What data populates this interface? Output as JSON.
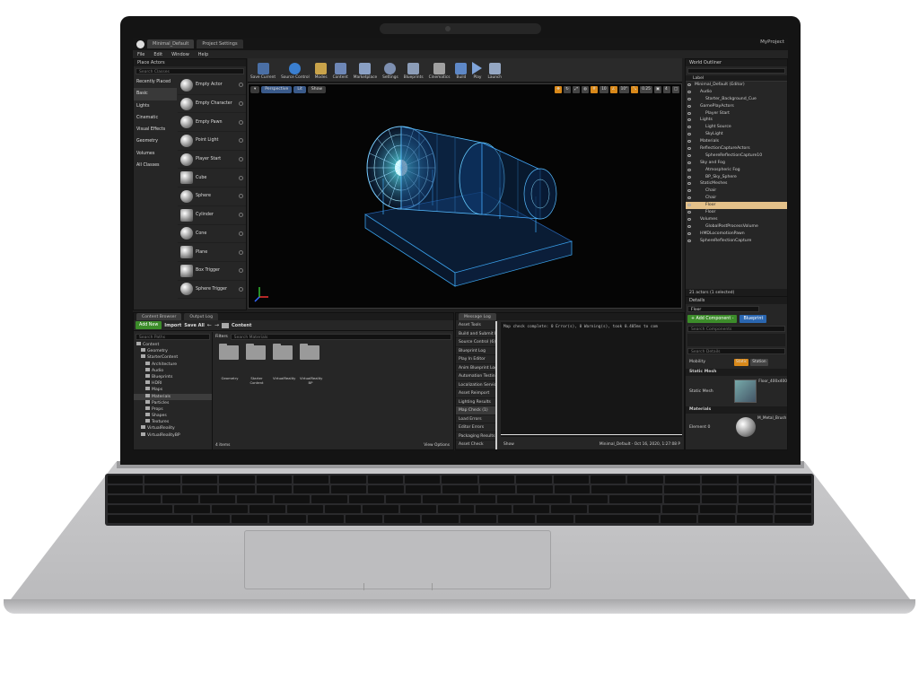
{
  "window": {
    "tabs": [
      "Minimal_Default",
      "Project Settings"
    ],
    "project": "MyProject"
  },
  "menu": [
    "File",
    "Edit",
    "Window",
    "Help"
  ],
  "place_actors": {
    "title": "Place Actors",
    "search_placeholder": "Search Classes",
    "categories": [
      "Recently Placed",
      "Basic",
      "Lights",
      "Cinematic",
      "Visual Effects",
      "Geometry",
      "Volumes",
      "All Classes"
    ],
    "items": [
      "Empty Actor",
      "Empty Character",
      "Empty Pawn",
      "Point Light",
      "Player Start",
      "Cube",
      "Sphere",
      "Cylinder",
      "Cone",
      "Plane",
      "Box Trigger",
      "Sphere Trigger"
    ]
  },
  "toolbar": [
    {
      "label": "Save Current",
      "color": "#4a6fa5"
    },
    {
      "label": "Source Control",
      "color": "#3a7fd0"
    },
    {
      "label": "Modes",
      "color": "#c9a34a"
    },
    {
      "label": "Content",
      "color": "#6e87b6"
    },
    {
      "label": "Marketplace",
      "color": "#8aa0c4"
    },
    {
      "label": "Settings",
      "color": "#7d8fb0"
    },
    {
      "label": "Blueprints",
      "color": "#8c9db8"
    },
    {
      "label": "Cinematics",
      "color": "#a0a0a0"
    },
    {
      "label": "Build",
      "color": "#5e88c7"
    },
    {
      "label": "Play",
      "color": "#7fa3d8"
    },
    {
      "label": "Launch",
      "color": "#94a6c2"
    }
  ],
  "viewport": {
    "perspective": "Perspective",
    "lit": "Lit",
    "show": "Show",
    "snap_values": [
      "10",
      "10°",
      "0.25",
      "4"
    ]
  },
  "outliner": {
    "title": "World Outliner",
    "column": "Label",
    "rows": [
      {
        "label": "Minimal_Default (Editor)",
        "indent": 0
      },
      {
        "label": "Audio",
        "indent": 1
      },
      {
        "label": "Starter_Background_Cue",
        "indent": 2
      },
      {
        "label": "GamePlayActors",
        "indent": 1
      },
      {
        "label": "Player Start",
        "indent": 2
      },
      {
        "label": "Lights",
        "indent": 1
      },
      {
        "label": "Light Source",
        "indent": 2
      },
      {
        "label": "SkyLight",
        "indent": 2
      },
      {
        "label": "Materials",
        "indent": 1
      },
      {
        "label": "ReflectionCaptureActors",
        "indent": 1
      },
      {
        "label": "SphereReflectionCapture10",
        "indent": 2
      },
      {
        "label": "Sky and Fog",
        "indent": 1
      },
      {
        "label": "Atmospheric Fog",
        "indent": 2
      },
      {
        "label": "BP_Sky_Sphere",
        "indent": 2
      },
      {
        "label": "StaticMeshes",
        "indent": 1
      },
      {
        "label": "Chair",
        "indent": 2
      },
      {
        "label": "Chair",
        "indent": 2
      },
      {
        "label": "Floor",
        "indent": 2,
        "selected": true
      },
      {
        "label": "Floor",
        "indent": 2
      },
      {
        "label": "Volumes",
        "indent": 1
      },
      {
        "label": "GlobalPostProcessVolume",
        "indent": 2
      },
      {
        "label": "HMDLocomotionPawn",
        "indent": 1
      },
      {
        "label": "SphereReflectionCapture",
        "indent": 1
      }
    ],
    "count": "21 actors (1 selected)"
  },
  "details": {
    "title": "Details",
    "name": "Floor",
    "add_component": "+ Add Component -",
    "blueprint": "Blueprint",
    "search_components": "Search Components",
    "search_details": "Search Details",
    "mobility": "Mobility",
    "static": "Static",
    "stationary": "Station",
    "static_mesh_section": "Static Mesh",
    "static_mesh_label": "Static Mesh",
    "mesh_name": "Floor_400x400",
    "materials_section": "Materials",
    "element": "Element 0",
    "material_name": "M_Metal_Brush"
  },
  "content_browser": {
    "tabs": [
      "Content Browser",
      "Output Log"
    ],
    "add_new": "Add New",
    "import": "Import",
    "save_all": "Save All",
    "path": "Content",
    "search_paths": "Search Paths",
    "filters": "Filters",
    "search_assets": "Search Materials",
    "tree": [
      {
        "label": "Content",
        "indent": 0
      },
      {
        "label": "Geometry",
        "indent": 1
      },
      {
        "label": "StarterContent",
        "indent": 1
      },
      {
        "label": "Architecture",
        "indent": 2
      },
      {
        "label": "Audio",
        "indent": 2
      },
      {
        "label": "Blueprints",
        "indent": 2
      },
      {
        "label": "HDRI",
        "indent": 2
      },
      {
        "label": "Maps",
        "indent": 2
      },
      {
        "label": "Materials",
        "indent": 2,
        "selected": true
      },
      {
        "label": "Particles",
        "indent": 2
      },
      {
        "label": "Props",
        "indent": 2
      },
      {
        "label": "Shapes",
        "indent": 2
      },
      {
        "label": "Textures",
        "indent": 2
      },
      {
        "label": "VirtualReality",
        "indent": 1
      },
      {
        "label": "VirtualRealityBP",
        "indent": 1
      }
    ],
    "folders": [
      "Geometry",
      "Starter Content",
      "VirtualReality",
      "VirtualReality BP"
    ],
    "count": "4 items",
    "view_options": "View Options"
  },
  "message_log": {
    "title": "Message Log",
    "categories": [
      "Asset Tools",
      "Build and Submit E",
      "Source Control (6)",
      "Blueprint Log",
      "Play In Editor",
      "Anim Blueprint Log",
      "Automation Testin",
      "Localization Servic",
      "Asset Reimport",
      "Lighting Results",
      "Map Check (1)",
      "Load Errors",
      "Editor Errors",
      "Packaging Results",
      "Asset Check"
    ],
    "selected": 10,
    "message": "Map check complete: 0 Error(s), 0 Warning(s), took 0.405ms to com",
    "show": "Show",
    "footer": "Minimal_Default - Oct 16, 2020, 1:27:08 P"
  }
}
